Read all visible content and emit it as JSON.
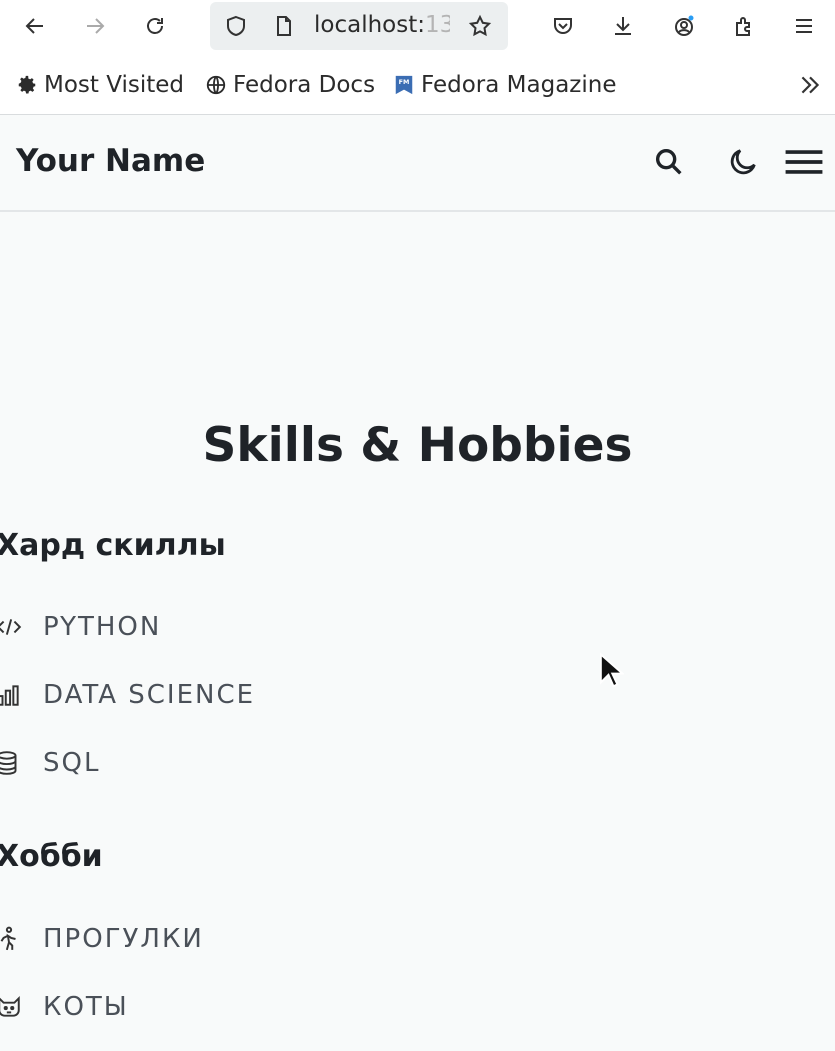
{
  "browser": {
    "url_visible": "localhost:",
    "url_faded": "13",
    "bookmarks": [
      {
        "label": "Most Visited",
        "icon": "gear-icon"
      },
      {
        "label": "Fedora Docs",
        "icon": "globe-icon"
      },
      {
        "label": "Fedora Magazine",
        "icon": "fedora-magazine-icon"
      }
    ]
  },
  "site": {
    "title": "Your Name",
    "header_icons": [
      "search-icon",
      "moon-icon",
      "hamburger-menu-icon"
    ]
  },
  "page": {
    "heading": "Skills & Hobbies",
    "sections": [
      {
        "title": "Хард скиллы",
        "items": [
          {
            "label": "PYTHON",
            "icon": "code-icon"
          },
          {
            "label": "DATA SCIENCE",
            "icon": "bar-chart-icon"
          },
          {
            "label": "SQL",
            "icon": "database-icon"
          }
        ]
      },
      {
        "title": "Хобби",
        "items": [
          {
            "label": "ПРОГУЛКИ",
            "icon": "walking-icon"
          },
          {
            "label": "КОТЫ",
            "icon": "cat-icon"
          }
        ]
      }
    ]
  }
}
